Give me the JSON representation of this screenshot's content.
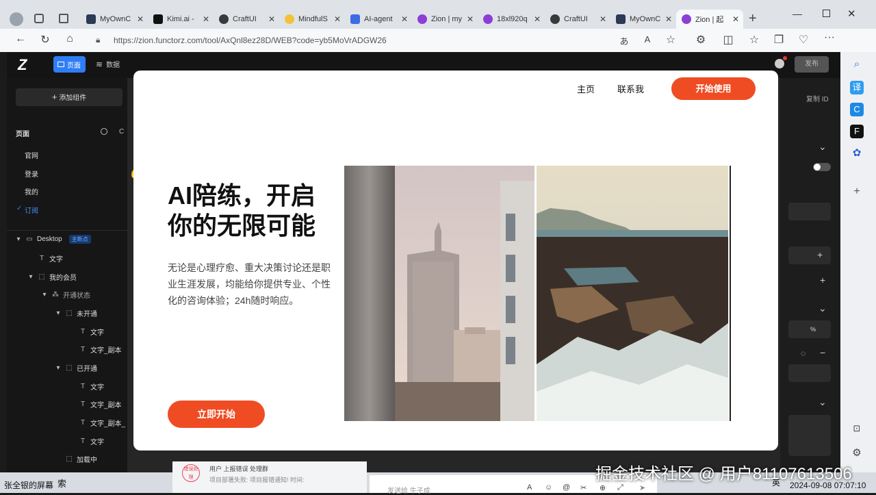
{
  "browser": {
    "tabs": [
      {
        "label": "MyOwnC",
        "color": "#2b3a55"
      },
      {
        "label": "Kimi.ai - ",
        "color": "#111111"
      },
      {
        "label": "CraftUI",
        "color": "#3a3a3a"
      },
      {
        "label": "MindfulS",
        "color": "#f3c23a"
      },
      {
        "label": "AI-agent",
        "color": "#3d6be6"
      },
      {
        "label": "Zion | my",
        "color": "#8c3fd6"
      },
      {
        "label": "18xl920q",
        "color": "#8c3fd6"
      },
      {
        "label": "CraftUI",
        "color": "#3a3a3a"
      },
      {
        "label": "MyOwnC",
        "color": "#2b3a55"
      },
      {
        "label": "Zion | 起",
        "color": "#8c3fd6"
      }
    ],
    "url": "https://zion.functorz.com/tool/AxQnl8ez28D/WEB?code=yb5MoVrADGW26"
  },
  "app": {
    "logo": "Z",
    "tab_page": "页面",
    "tab_data": "数据",
    "publish": "发布",
    "copy_id": "复制 ID",
    "add_component": "添加组件",
    "pages_title": "页面",
    "pages": [
      "官网",
      "登录",
      "我的",
      "订阅"
    ],
    "tree": {
      "desktop": "Desktop",
      "badge": "主断点",
      "text": "文字",
      "my_member": "我的会员",
      "open_state": "开通状态",
      "not_open": "未开通",
      "text_copy": "文字_副本",
      "opened": "已开通",
      "text_copy2": "文字_副本_",
      "loading": "加载中"
    },
    "unit": "%"
  },
  "preview": {
    "nav_home": "主页",
    "nav_contact": "联系我",
    "nav_cta": "开始使用",
    "headline_line1": "AI陪练，开启",
    "headline_line2": "你的无限可能",
    "description": "无论是心理疗愈、重大决策讨论还是职业生涯发展，均能给你提供专业、个性化的咨询体验；24h随时响应。",
    "cta": "立即开始"
  },
  "taskbar": {
    "left": "张全银的屏幕",
    "search": "索",
    "chat_line1": "用户   上报错误 处理群",
    "chat_line2": "项目部署失败: 项目报错通知! 时间:",
    "chat_badge": "错误处理",
    "chat_input": "发送给 牛子成",
    "lang": "英",
    "datetime": "2024-09-08 07:07:10",
    "watermark": "掘金技术社区 @ 用户81107613506"
  },
  "colors": {
    "accent": "#ef4c23",
    "app_blue": "#2f7df6"
  }
}
